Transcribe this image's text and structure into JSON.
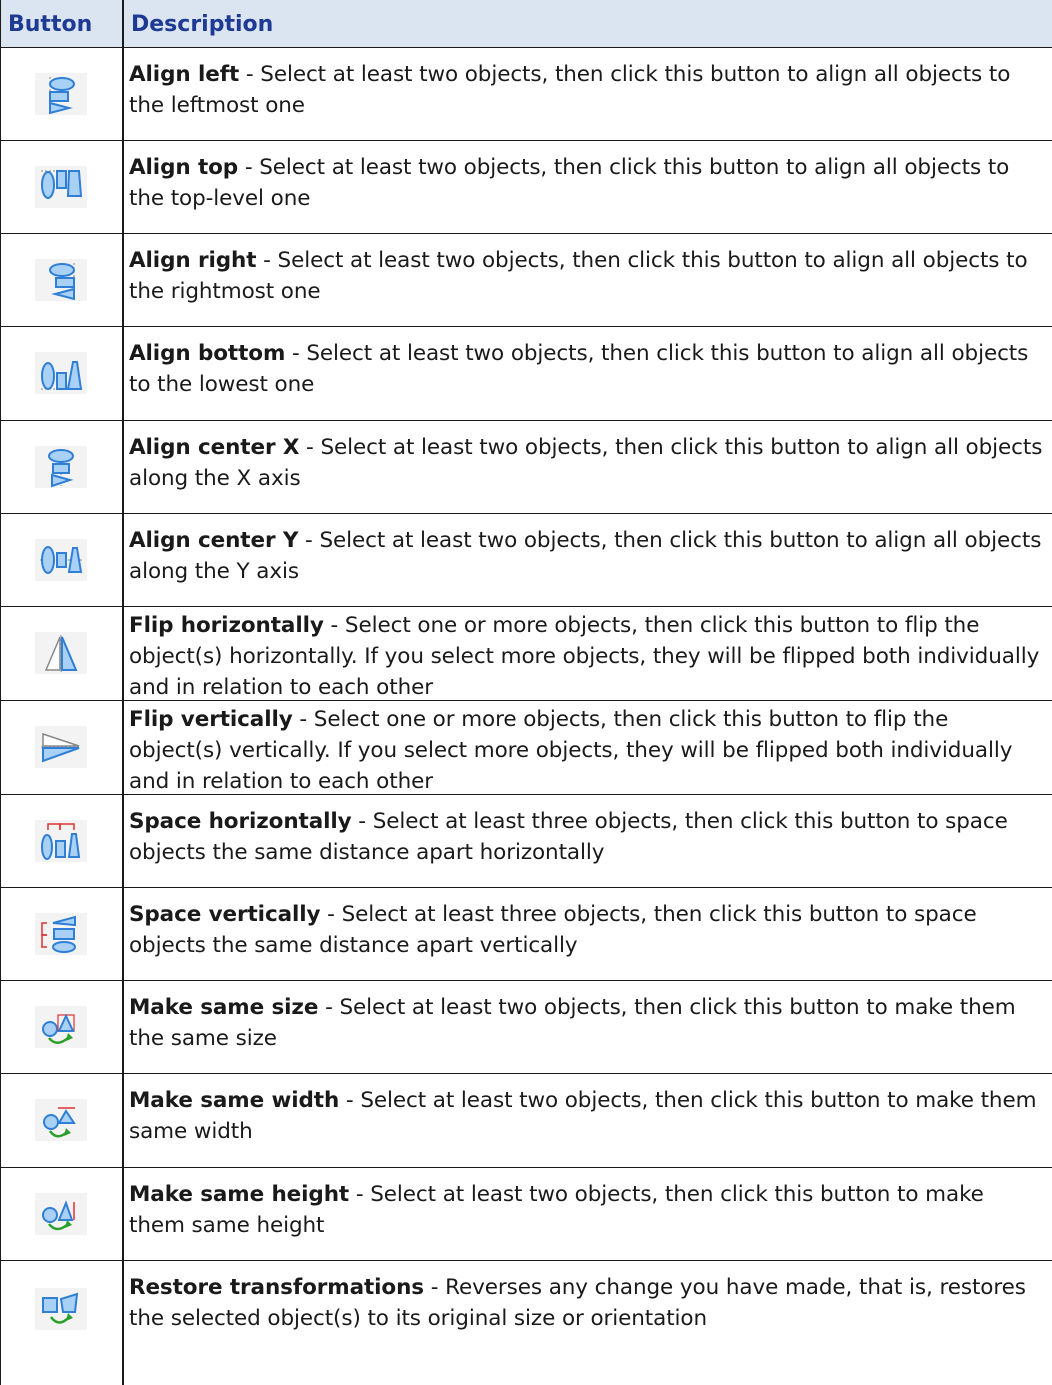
{
  "header": {
    "button": "Button",
    "description": "Description"
  },
  "rows": [
    {
      "icon": "align-left-icon",
      "title": "Align left",
      "text": " - Select at least two objects, then click this button to align all objects to the leftmost one"
    },
    {
      "icon": "align-top-icon",
      "title": "Align top",
      "text": " - Select at least two objects, then click this button to align all objects to the top-level one"
    },
    {
      "icon": "align-right-icon",
      "title": "Align right",
      "text": " - Select at least two objects, then click this button to align all objects to the rightmost one"
    },
    {
      "icon": "align-bottom-icon",
      "title": "Align bottom",
      "text": " - Select at least two objects, then click this button to align all objects to the lowest one"
    },
    {
      "icon": "align-center-x-icon",
      "title": "Align center X",
      "text": " - Select at least two objects, then click this button to align all objects along the X axis"
    },
    {
      "icon": "align-center-y-icon",
      "title": "Align center Y",
      "text": " - Select at least two objects, then click this button to align all objects along the Y axis"
    },
    {
      "icon": "flip-horizontally-icon",
      "title": "Flip horizontally",
      "text": " - Select one or more objects, then click this button to flip the object(s) horizontally. If you select more objects, they will be flipped both individually and in relation to each other"
    },
    {
      "icon": "flip-vertically-icon",
      "title": "Flip vertically",
      "text": " - Select one or more objects, then click this button to flip the object(s) vertically. If you select more objects, they will be flipped both individually and in relation to each other"
    },
    {
      "icon": "space-horizontally-icon",
      "title": "Space horizontally",
      "text": " - Select at least three objects, then click this button to space objects the same distance apart horizontally"
    },
    {
      "icon": "space-vertically-icon",
      "title": "Space vertically",
      "text": " - Select at least three objects, then click this button to space objects the same distance apart vertically"
    },
    {
      "icon": "make-same-size-icon",
      "title": "Make same size",
      "text": " - Select at least two objects, then click this button to make them the same size"
    },
    {
      "icon": "make-same-width-icon",
      "title": "Make same width",
      "text": " - Select at least two objects, then click this button to make them same width"
    },
    {
      "icon": "make-same-height-icon",
      "title": "Make same height",
      "text": " - Select at least two objects, then click this button to make them same height"
    },
    {
      "icon": "restore-transformations-icon",
      "title": "Restore transformations",
      "text": " - Reverses any change you have made, that is, restores the selected object(s) to its original size or orientation"
    }
  ]
}
